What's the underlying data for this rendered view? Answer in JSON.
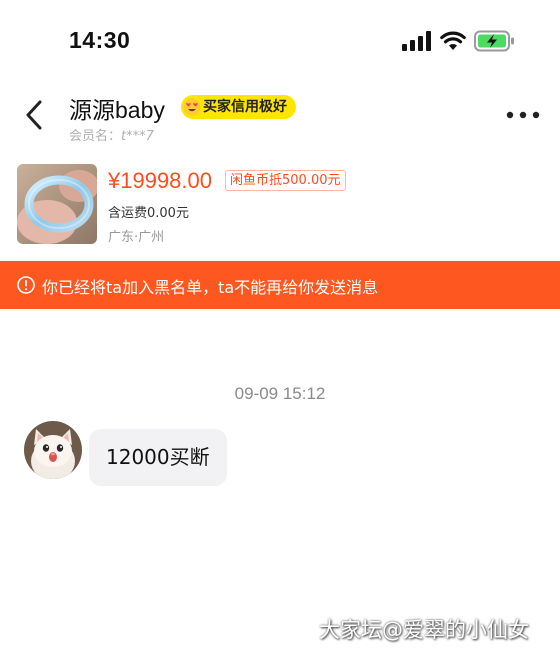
{
  "status_bar": {
    "time": "14:30"
  },
  "header": {
    "contact_name": "源源baby",
    "badge": "买家信用极好",
    "member_label": "会员名：",
    "member_id": "t***7"
  },
  "product": {
    "price": "¥19998.00",
    "coin_discount": "闲鱼币抵500.00元",
    "shipping": "含运费0.00元",
    "location": "广东·广州"
  },
  "banner": {
    "message": "你已经将ta加入黑名单，ta不能再给你发送消息"
  },
  "chat": {
    "timestamp": "09-09 15:12",
    "messages": [
      {
        "text": "12000买断"
      }
    ]
  },
  "watermark": "大家坛@爱翠的小仙女",
  "colors": {
    "accent": "#ff4c1f",
    "banner": "#ff5720",
    "badge": "#ffe600",
    "bubble": "#f2f2f4",
    "battery_charge": "#4cd964"
  }
}
